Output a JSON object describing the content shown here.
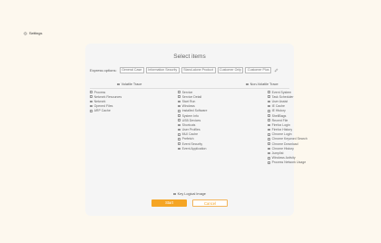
{
  "topbar": {
    "settings_label": "Settings"
  },
  "panel": {
    "title": "Select items",
    "express_label": "Express options:",
    "express_options": [
      "General Case",
      "Information Security",
      "Stand-alone Product",
      "Customer Only",
      "Customer Plus"
    ],
    "volatile_label": "Volatile Trace",
    "nonvolatile_label": "Non-Volatile Trace",
    "columns": [
      [
        "Process",
        "Network Resources",
        "Network",
        "Opened Files",
        "ARP Cache"
      ],
      [
        "Service",
        "Service Detail",
        "Start Run",
        "Windows",
        "Installed Software",
        "System Info",
        "USB Devices",
        "Shortcuts",
        "User Profiles",
        "MUI Cache",
        "Prefetch",
        "Event Security",
        "Event Application"
      ],
      [
        "Event System",
        "Task Scheduler",
        "User Assist",
        "IE Cache",
        "IE History",
        "ShellBags",
        "Recent File",
        "Firefox Login",
        "Firefox History",
        "Chrome Login",
        "Chrome Keyword Search",
        "Chrome Download",
        "Chrome History",
        "Jumplist",
        "Windows Activity",
        "Process Network Usage"
      ]
    ],
    "keylogger_label": "Key Logical Image",
    "start_label": "Start",
    "cancel_label": "Cancel"
  },
  "colors": {
    "accent": "#f5a524",
    "background": "#fdf8ee",
    "panel": "#f5f5f5"
  },
  "icons": {
    "settings": "gear-icon",
    "edit": "pencil-icon"
  }
}
